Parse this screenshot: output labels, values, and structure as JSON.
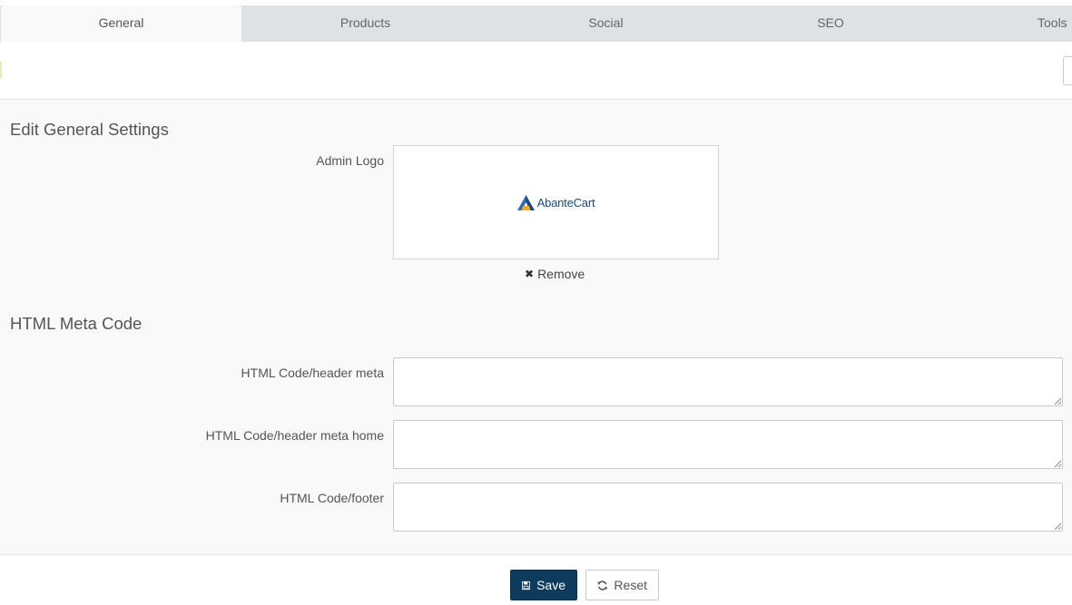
{
  "tabs": [
    {
      "label": "General",
      "active": true
    },
    {
      "label": "Products",
      "active": false
    },
    {
      "label": "Social",
      "active": false
    },
    {
      "label": "SEO",
      "active": false
    },
    {
      "label": "Tools",
      "active": false
    }
  ],
  "general_section": {
    "title": "Edit General Settings",
    "admin_logo_label": "Admin Logo",
    "logo_text": "AbanteCart",
    "remove_label": "Remove"
  },
  "meta_section": {
    "title": "HTML Meta Code",
    "fields": [
      {
        "label": "HTML Code/header meta",
        "value": ""
      },
      {
        "label": "HTML Code/header meta home",
        "value": ""
      },
      {
        "label": "HTML Code/footer",
        "value": ""
      }
    ]
  },
  "actions": {
    "save_label": "Save",
    "reset_label": "Reset"
  },
  "colors": {
    "save_button": "#0e3a5b",
    "tab_bar": "#dfe1e4",
    "content_bg": "#f9f9f9"
  },
  "icons": {
    "save": "floppy-disk-icon",
    "reset": "refresh-icon",
    "remove": "close-icon"
  }
}
